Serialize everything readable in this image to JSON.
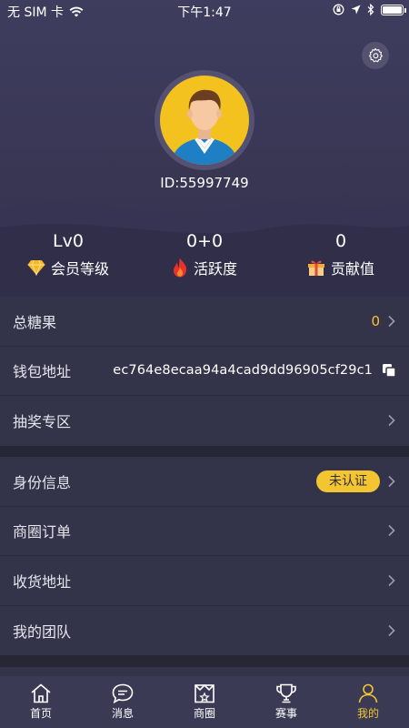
{
  "status_bar": {
    "carrier": "无 SIM 卡",
    "time": "下午1:47"
  },
  "profile": {
    "user_id": "ID:55997749",
    "avatar_icon": "user-avatar-icon",
    "settings_icon": "gear-icon"
  },
  "stats": [
    {
      "value": "Lv0",
      "label": "会员等级",
      "icon": "diamond-icon"
    },
    {
      "value": "0+0",
      "label": "活跃度",
      "icon": "flame-icon"
    },
    {
      "value": "0",
      "label": "贡献值",
      "icon": "gift-icon"
    }
  ],
  "section1": {
    "candy": {
      "label": "总糖果",
      "value": "0"
    },
    "wallet": {
      "label": "钱包地址",
      "value": "ec764e8ecaa94a4cad9dd96905cf29c1"
    },
    "lottery": {
      "label": "抽奖专区"
    }
  },
  "section2": {
    "identity": {
      "label": "身份信息",
      "badge": "未认证"
    },
    "orders": {
      "label": "商圈订单"
    },
    "address": {
      "label": "收货地址"
    },
    "team": {
      "label": "我的团队"
    }
  },
  "tabs": [
    {
      "label": "首页",
      "icon": "home-icon"
    },
    {
      "label": "消息",
      "icon": "message-icon"
    },
    {
      "label": "商圈",
      "icon": "shop-icon"
    },
    {
      "label": "赛事",
      "icon": "trophy-icon"
    },
    {
      "label": "我的",
      "icon": "person-icon"
    }
  ],
  "colors": {
    "accent": "#f2c531",
    "header_bg": "#3f3d5e",
    "list_bg": "#33334a",
    "tabbar_bg": "#3b3a55"
  }
}
